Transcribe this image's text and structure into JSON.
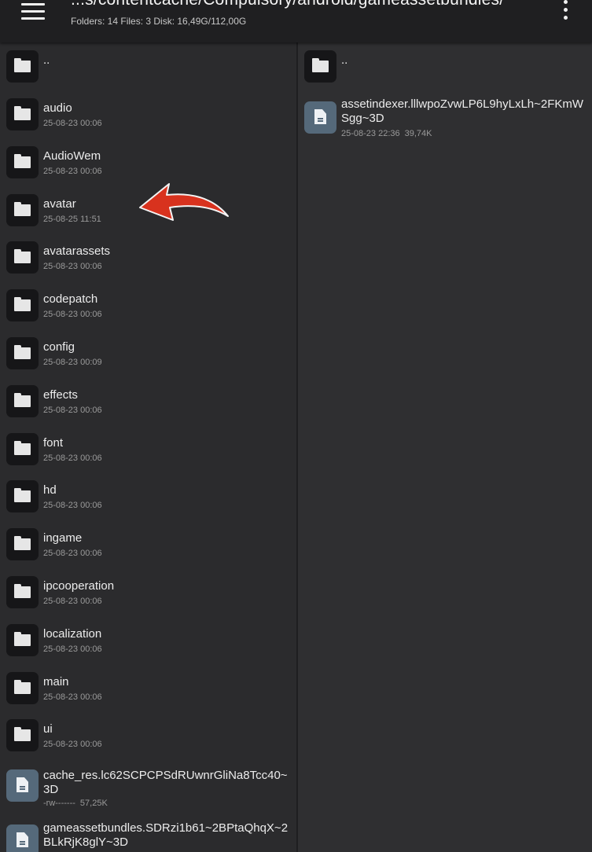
{
  "header": {
    "path": "...s/contentcache/Compulsory/android/gameassetbundles/",
    "stats": "Folders: 14  Files: 3  Disk: 16,49G/112,00G"
  },
  "left_pane": {
    "parent": "..",
    "items": [
      {
        "name": "audio",
        "meta": "25-08-23 00:06",
        "type": "folder"
      },
      {
        "name": "AudioWem",
        "meta": "25-08-23 00:06",
        "type": "folder"
      },
      {
        "name": "avatar",
        "meta": "25-08-25 11:51",
        "type": "folder"
      },
      {
        "name": "avatarassets",
        "meta": "25-08-23 00:06",
        "type": "folder"
      },
      {
        "name": "codepatch",
        "meta": "25-08-23 00:06",
        "type": "folder"
      },
      {
        "name": "config",
        "meta": "25-08-23 00:09",
        "type": "folder"
      },
      {
        "name": "effects",
        "meta": "25-08-23 00:06",
        "type": "folder"
      },
      {
        "name": "font",
        "meta": "25-08-23 00:06",
        "type": "folder"
      },
      {
        "name": "hd",
        "meta": "25-08-23 00:06",
        "type": "folder"
      },
      {
        "name": "ingame",
        "meta": "25-08-23 00:06",
        "type": "folder"
      },
      {
        "name": "ipcooperation",
        "meta": "25-08-23 00:06",
        "type": "folder"
      },
      {
        "name": "localization",
        "meta": "25-08-23 00:06",
        "type": "folder"
      },
      {
        "name": "main",
        "meta": "25-08-23 00:06",
        "type": "folder"
      },
      {
        "name": "ui",
        "meta": "25-08-23 00:06",
        "type": "folder"
      }
    ],
    "files": [
      {
        "name": "cache_res.lc62SCPCPSdRUwnrGliNa8Tcc40~3D",
        "perms": "-rw-------",
        "size": "57,25K"
      },
      {
        "name": "gameassetbundles.SDRzi1b61~2BPtaQhqX~2BLkRjK8glY~3D"
      }
    ]
  },
  "right_pane": {
    "parent": "..",
    "file": {
      "name": "assetindexer.lllwpoZvwLP6L9hyLxLh~2FKmWSgg~3D",
      "date": "25-08-23 22:36",
      "size": "39,74K"
    }
  },
  "colors": {
    "arrow": "#d8321e",
    "file_icon_bg": "#55697a",
    "folder_icon_bg": "#161618"
  },
  "icons": {
    "menu": "hamburger-icon",
    "overflow": "more-vert-icon",
    "folder": "folder-icon",
    "file": "file-icon",
    "annotation": "red-arrow-icon"
  }
}
